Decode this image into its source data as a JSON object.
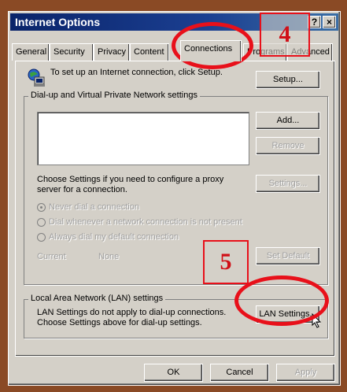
{
  "window": {
    "title": "Internet Options",
    "help_glyph": "?",
    "close_glyph": "×"
  },
  "tabs": [
    {
      "label": "General"
    },
    {
      "label": "Security"
    },
    {
      "label": "Privacy"
    },
    {
      "label": "Content"
    },
    {
      "label": "Connections"
    },
    {
      "label": "Programs"
    },
    {
      "label": "Advanced"
    }
  ],
  "setup": {
    "text": "To set up an Internet connection, click Setup.",
    "button": "Setup..."
  },
  "dialup": {
    "group_label": "Dial-up and Virtual Private Network settings",
    "add": "Add...",
    "remove": "Remove",
    "proxy_text": "Choose Settings if you need to configure a proxy server for a connection.",
    "settings": "Settings...",
    "radio_never": "Never dial a connection",
    "radio_whenever": "Dial whenever a network connection is not present",
    "radio_always": "Always dial my default connection",
    "current_label": "Current",
    "current_value": "None",
    "set_default": "Set Default"
  },
  "lan": {
    "group_label": "Local Area Network (LAN) settings",
    "text": "LAN Settings do not apply to dial-up connections. Choose Settings above for dial-up settings.",
    "button": "LAN Settings..."
  },
  "footer": {
    "ok": "OK",
    "cancel": "Cancel",
    "apply": "Apply"
  },
  "annotations": {
    "step4": "4",
    "step5": "5"
  }
}
